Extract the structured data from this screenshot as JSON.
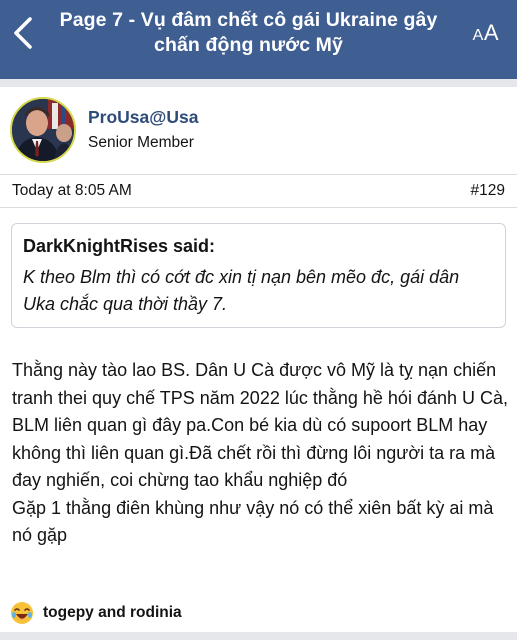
{
  "header": {
    "title": "Page 7 - Vụ đâm chết cô gái Ukraine gây chấn động nước Mỹ",
    "font_size_small": "A",
    "font_size_large": "A"
  },
  "post": {
    "author": {
      "username": "ProUsa@Usa",
      "title": "Senior Member"
    },
    "date": "Today at 8:05 AM",
    "number": "#129",
    "quote": {
      "author": "DarkKnightRises said:",
      "text": "K theo Blm thì có cớt đc xin tị nạn bên mẽo đc, gái dân Uka chắc qua thời thầy 7."
    },
    "body": [
      "Thằng này tào lao BS. Dân U Cà được vô Mỹ là tỵ nạn chiến tranh thei quy chế TPS năm 2022 lúc thằng hề hói đánh U Cà, BLM liên quan gì đây pa.Con bé kia dù có supoort BLM hay không thì liên quan gì.Đã chết rồi thì đừng lôi người ta ra mà đay nghiến, coi chừng tao khẩu nghiệp đó",
      "Gặp 1 thằng điên khùng như vậy nó có thể xiên bất kỳ ai mà nó gặp"
    ],
    "reactions": {
      "users": "togepy and rodinia",
      "icon": "haha-laughing-emoji"
    }
  },
  "colors": {
    "header_bg": "#3f5e91",
    "username": "#2e4b7a",
    "divider": "#e6e7ea"
  }
}
